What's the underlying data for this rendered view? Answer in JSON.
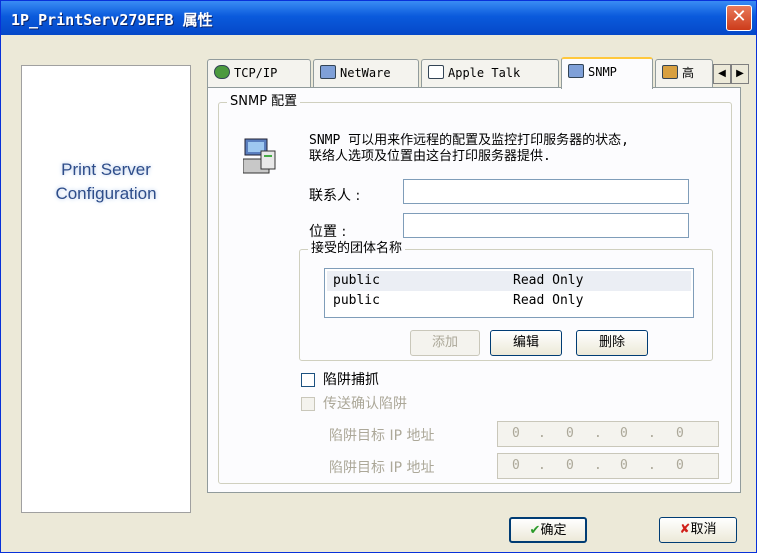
{
  "window": {
    "title": "1P_PrintServ279EFB 属性",
    "close_glyph": "✕"
  },
  "left_panel": {
    "title_line1": "Print Server",
    "title_line2": "Configuration"
  },
  "tabs": [
    {
      "label": "TCP/IP",
      "icon": "network-globe-icon"
    },
    {
      "label": "NetWare",
      "icon": "netware-computer-icon"
    },
    {
      "label": "Apple Talk",
      "icon": "appletalk-icon"
    },
    {
      "label": "SNMP",
      "icon": "snmp-computer-icon",
      "active": true
    },
    {
      "label": "高",
      "icon": "advanced-icon"
    }
  ],
  "tab_arrows": {
    "left": "◀",
    "right": "▶"
  },
  "snmp_group": {
    "legend": "SNMP 配置",
    "description_line1": "SNMP 可以用来作远程的配置及监控打印服务器的状态,",
    "description_line2": "联络人选项及位置由这台打印服务器提供.",
    "contact_label": "联系人 :",
    "contact_value": "",
    "location_label": "位置 :",
    "location_value": ""
  },
  "community_group": {
    "legend": "接受的团体名称",
    "rows": [
      {
        "name": "public",
        "access": "Read Only"
      },
      {
        "name": "public",
        "access": "Read Only"
      }
    ],
    "add_label": "添加",
    "edit_label": "编辑",
    "delete_label": "删除"
  },
  "trap": {
    "enable_label": "陷阱捕抓",
    "confirm_label": "传送确认陷阱",
    "target1_label": "陷阱目标 IP 地址",
    "target1_octets": [
      "0",
      "0",
      "0",
      "0"
    ],
    "target2_label": "陷阱目标 IP 地址",
    "target2_octets": [
      "0",
      "0",
      "0",
      "0"
    ],
    "ip_separator": "."
  },
  "footer": {
    "ok_label": "确定",
    "cancel_label": "取消",
    "ok_icon": "check-icon",
    "cancel_icon": "x-icon",
    "ok_glyph": "✔",
    "cancel_glyph": "✘"
  },
  "colors": {
    "titlebar": "#0a5adc",
    "left_title": "#2e4d8a",
    "ok_check": "#2a9a2a",
    "cancel_x": "#d0201a"
  }
}
